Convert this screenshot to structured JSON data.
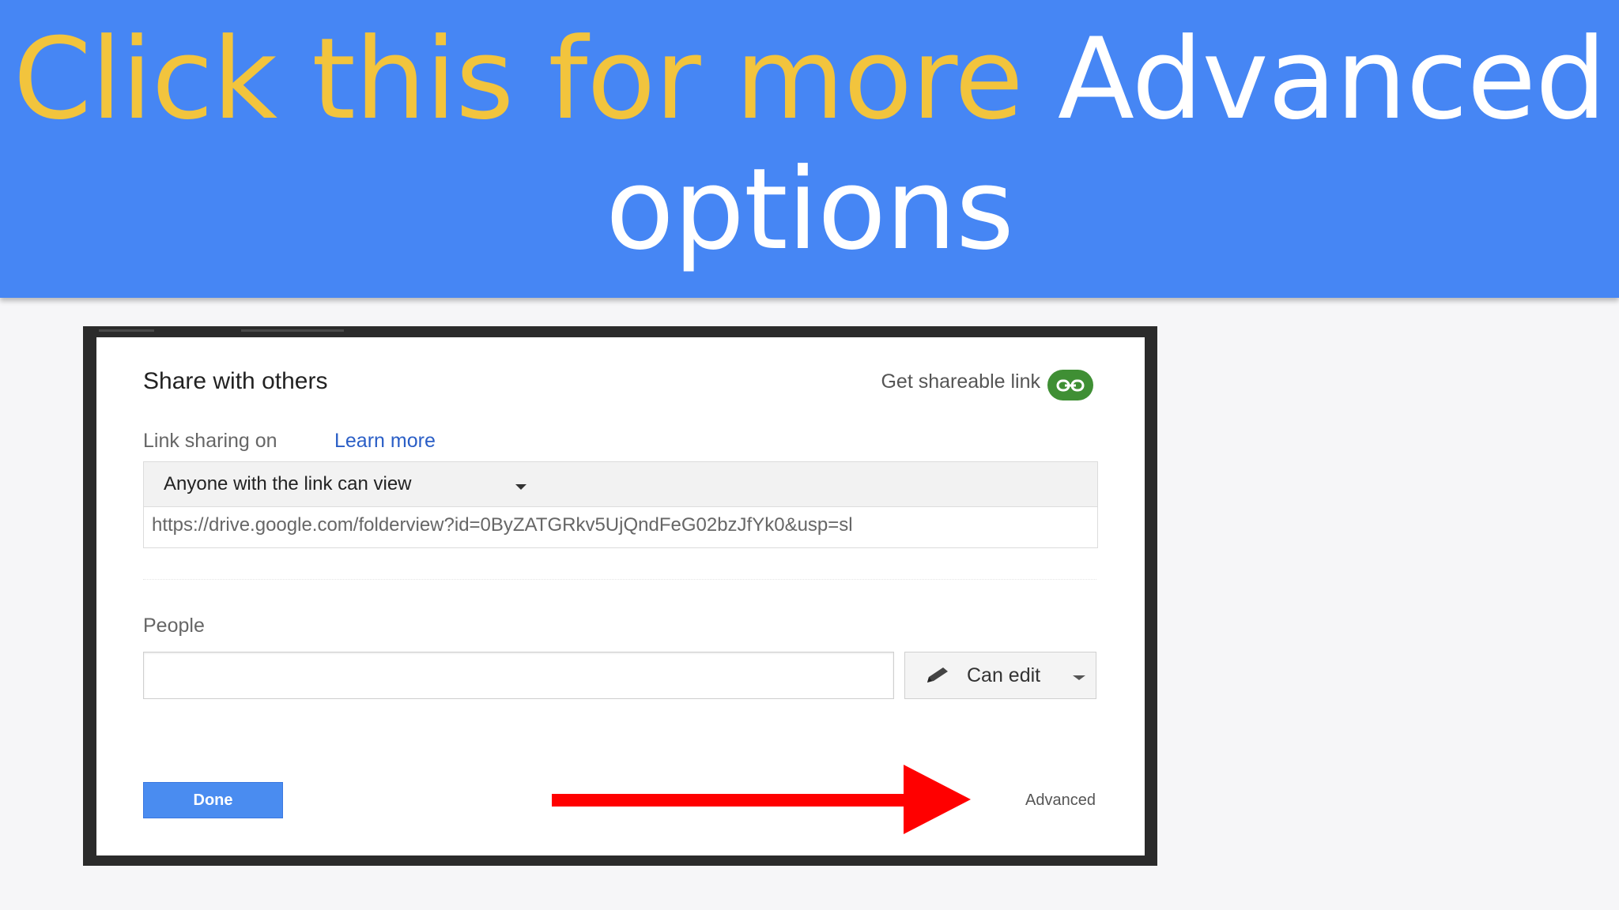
{
  "banner": {
    "headline_part1": "Click this for more ",
    "headline_part2": "Advanced options",
    "background_color": "#4686f4",
    "highlight_color": "#f2c43d"
  },
  "dialog": {
    "title": "Share with others",
    "shareable_link_label": "Get shareable link",
    "link_icon": "link-icon",
    "link_sharing_label": "Link sharing on",
    "learn_more_label": "Learn more",
    "access_option": "Anyone with the link can view",
    "share_url": "https://drive.google.com/folderview?id=0ByZATGRkv5UjQndFeG02bzJfYk0&usp=sl",
    "people_label": "People",
    "people_input_value": "",
    "permission_label": "Can edit",
    "permission_icon": "pencil-icon",
    "done_label": "Done",
    "advanced_label": "Advanced"
  },
  "annotation": {
    "arrow_icon": "red-arrow-icon",
    "arrow_color": "#ff0000"
  }
}
